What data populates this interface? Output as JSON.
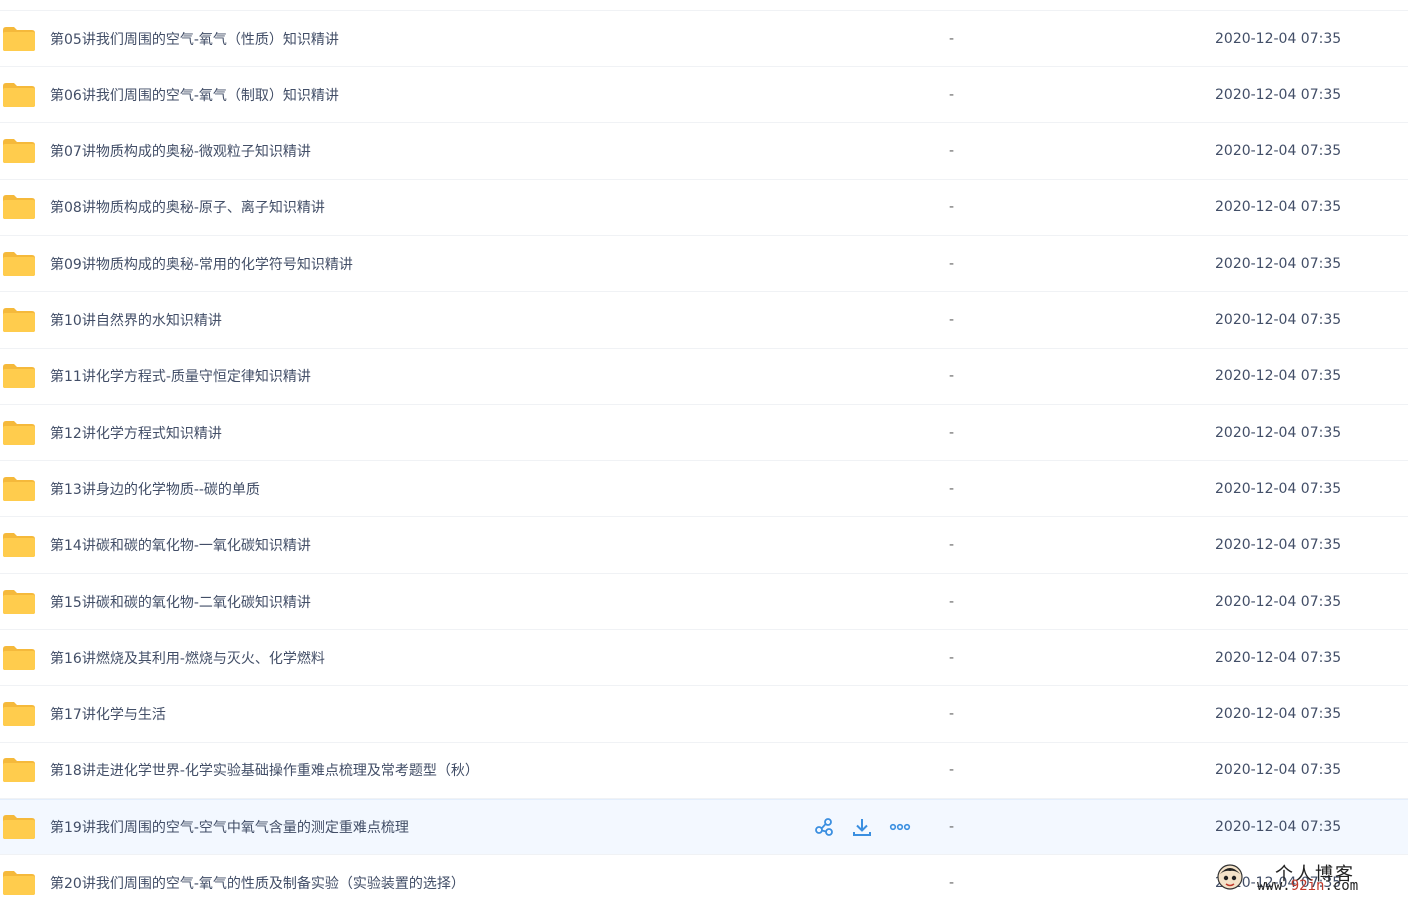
{
  "colors": {
    "folder": "#ffcc4d",
    "folder_dark": "#f5b93b",
    "accent": "#3b8fe0",
    "text": "#424e67",
    "hover_bg": "#f3f8ff"
  },
  "files": [
    {
      "name": "第05讲我们周围的空气-氧气（性质）知识精讲",
      "size": "-",
      "date": "2020-12-04 07:35"
    },
    {
      "name": "第06讲我们周围的空气-氧气（制取）知识精讲",
      "size": "-",
      "date": "2020-12-04 07:35"
    },
    {
      "name": "第07讲物质构成的奥秘-微观粒子知识精讲",
      "size": "-",
      "date": "2020-12-04 07:35"
    },
    {
      "name": "第08讲物质构成的奥秘-原子、离子知识精讲",
      "size": "-",
      "date": "2020-12-04 07:35"
    },
    {
      "name": "第09讲物质构成的奥秘-常用的化学符号知识精讲",
      "size": "-",
      "date": "2020-12-04 07:35"
    },
    {
      "name": "第10讲自然界的水知识精讲",
      "size": "-",
      "date": "2020-12-04 07:35"
    },
    {
      "name": "第11讲化学方程式-质量守恒定律知识精讲",
      "size": "-",
      "date": "2020-12-04 07:35"
    },
    {
      "name": "第12讲化学方程式知识精讲",
      "size": "-",
      "date": "2020-12-04 07:35"
    },
    {
      "name": "第13讲身边的化学物质--碳的单质",
      "size": "-",
      "date": "2020-12-04 07:35"
    },
    {
      "name": "第14讲碳和碳的氧化物-一氧化碳知识精讲",
      "size": "-",
      "date": "2020-12-04 07:35"
    },
    {
      "name": "第15讲碳和碳的氧化物-二氧化碳知识精讲",
      "size": "-",
      "date": "2020-12-04 07:35"
    },
    {
      "name": "第16讲燃烧及其利用-燃烧与灭火、化学燃料",
      "size": "-",
      "date": "2020-12-04 07:35"
    },
    {
      "name": "第17讲化学与生活",
      "size": "-",
      "date": "2020-12-04 07:35"
    },
    {
      "name": "第18讲走进化学世界-化学实验基础操作重难点梳理及常考题型（秋）",
      "size": "-",
      "date": "2020-12-04 07:35"
    },
    {
      "name": "第19讲我们周围的空气-空气中氧气含量的测定重难点梳理",
      "size": "-",
      "date": "2020-12-04 07:35",
      "hovered": true
    },
    {
      "name": "第20讲我们周围的空气-氧气的性质及制备实验（实验装置的选择）",
      "size": "-",
      "date": "2020-12-04 07:35"
    }
  ],
  "row_actions": [
    "share-icon",
    "download-icon",
    "more-icon"
  ],
  "watermark": {
    "title": "个人博客",
    "url_prefix": "www.",
    "url_highlight": "92in",
    "url_suffix": ".com"
  }
}
